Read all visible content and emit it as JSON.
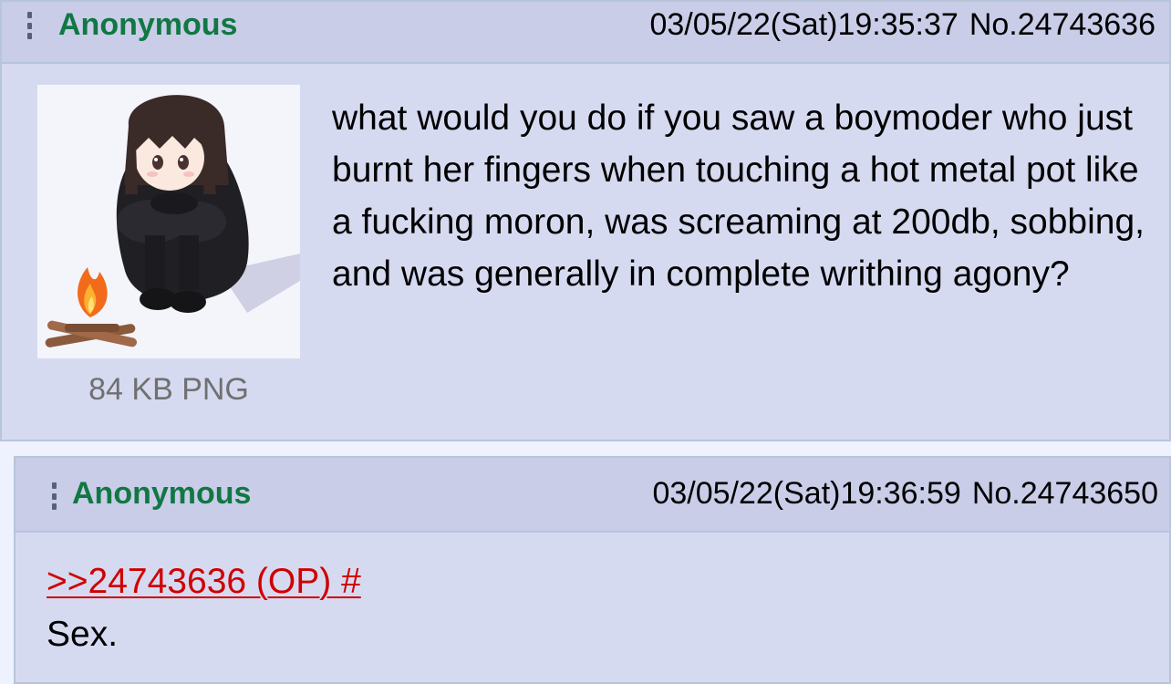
{
  "op_post": {
    "name": "Anonymous",
    "datetime": "03/05/22(Sat)19:35:37",
    "post_number": "No.24743636",
    "file_info": "84 KB PNG",
    "message": "what would you do if you saw a boymoder who just burnt her fingers when touching a hot metal pot like a fucking moron, was screaming at 200db, sobbing, and was generally in complete writhing agony?"
  },
  "reply_post": {
    "name": "Anonymous",
    "datetime": "03/05/22(Sat)19:36:59",
    "post_number": "No.24743650",
    "quote_link": ">>24743636 (OP) #",
    "message": "Sex."
  },
  "colors": {
    "post_background": "#d6daf0",
    "header_background": "#c9cde8",
    "border": "#b7c5d9",
    "name": "#117743",
    "quote_link": "#d00000"
  },
  "icons": {
    "post_menu": "vertical-dots-icon"
  }
}
